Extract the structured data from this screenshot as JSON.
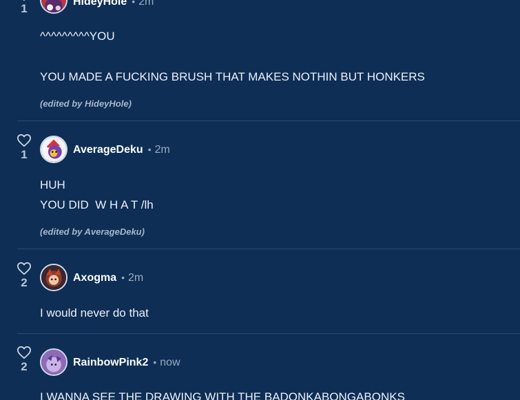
{
  "comments": [
    {
      "author": "HideyHole",
      "time": "2m",
      "likes": "1",
      "lines": [
        "^^^^^^^^^YOU",
        "YOU MADE A FUCKING BRUSH THAT MAKES NOTHIN BUT HONKERS"
      ],
      "edited": "(edited by HideyHole)"
    },
    {
      "author": "AverageDeku",
      "time": "2m",
      "likes": "1",
      "lines": [
        "HUH",
        "YOU DID  W H A T /lh"
      ],
      "edited": "(edited by AverageDeku)"
    },
    {
      "author": "Axogma",
      "time": "2m",
      "likes": "2",
      "lines": [
        "I would never do that"
      ]
    },
    {
      "author": "RainbowPink2",
      "time": "now",
      "likes": "2",
      "lines": [
        "I WANNA SEE THE DRAWING WITH THE BADONKABONGABONKS"
      ]
    }
  ],
  "separator": "•",
  "icons": {
    "like": "heart-outline-icon"
  },
  "colors": {
    "background": "#0e2e55",
    "divider": "#2d4c73",
    "muted_text": "#9aabc2"
  }
}
